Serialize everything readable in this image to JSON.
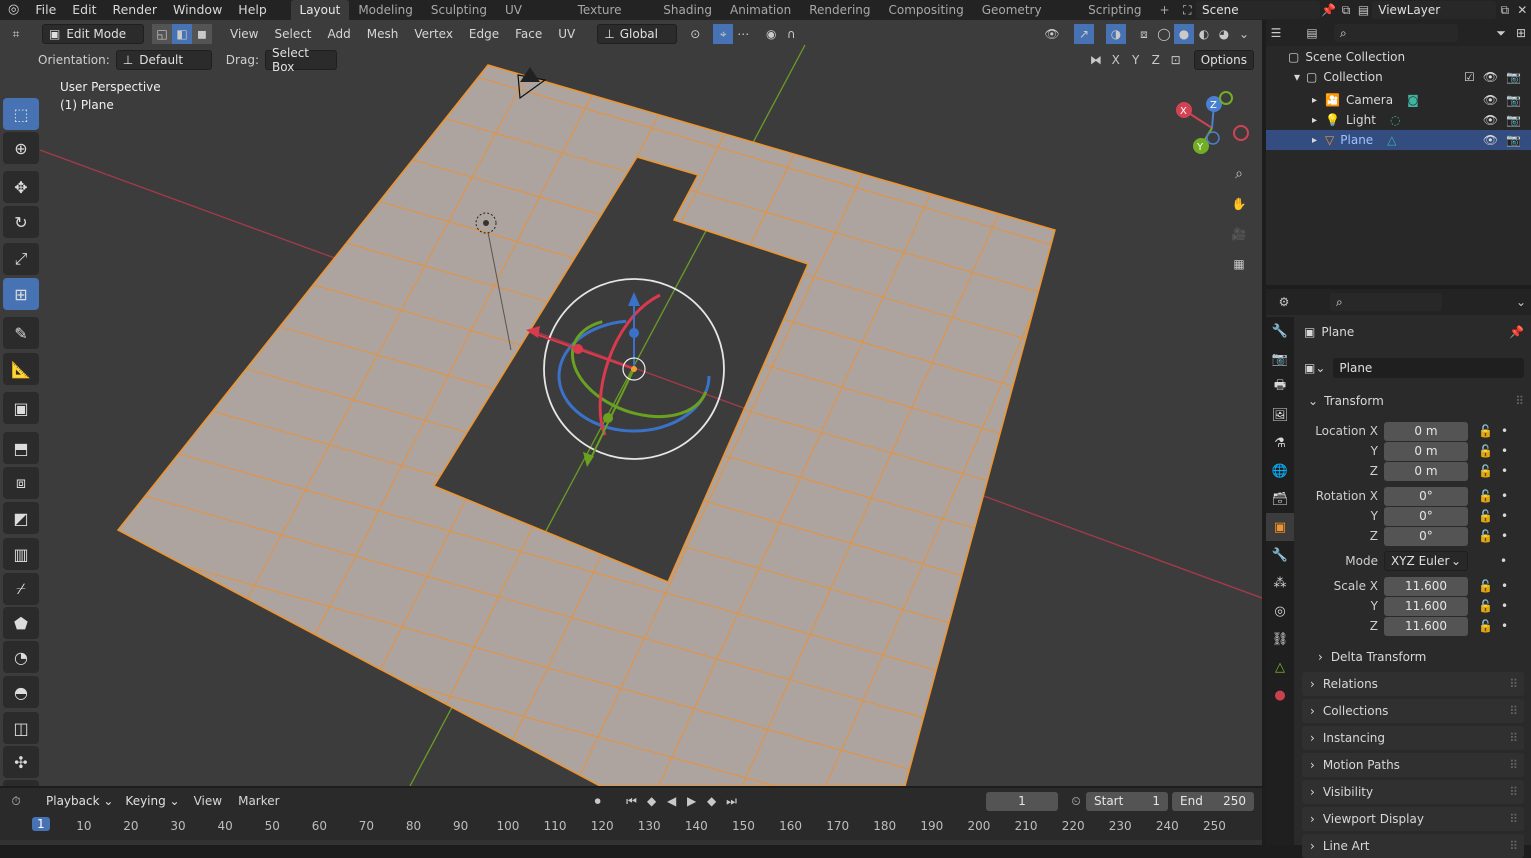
{
  "topbar": {
    "menus": [
      "File",
      "Edit",
      "Render",
      "Window",
      "Help"
    ],
    "workspaces": [
      "Layout",
      "Modeling",
      "Sculpting",
      "UV Editing",
      "Texture Paint",
      "Shading",
      "Animation",
      "Rendering",
      "Compositing",
      "Geometry Nodes",
      "Scripting"
    ],
    "active_workspace": "Layout",
    "add_tab": "+",
    "scene": "Scene",
    "view_layer": "ViewLayer"
  },
  "viewport_header": {
    "mode": "Edit Mode",
    "menus": [
      "View",
      "Select",
      "Add",
      "Mesh",
      "Vertex",
      "Edge",
      "Face",
      "UV"
    ],
    "transform_orientation": "Global",
    "orientation_label": "Orientation:",
    "orientation_value": "Default",
    "drag_label": "Drag:",
    "drag_value": "Select Box",
    "axes": [
      "X",
      "Y",
      "Z"
    ],
    "options": "Options"
  },
  "viewport": {
    "perspective": "User Perspective",
    "object": "(1) Plane",
    "gizmo_axes": {
      "x": "X",
      "y": "Y",
      "z": "Z"
    }
  },
  "tools": [
    {
      "name": "select-box-tool",
      "active": true,
      "glyph": "⬚"
    },
    {
      "name": "cursor-tool",
      "glyph": "⊕"
    },
    {
      "name": "move-tool",
      "glyph": "✥"
    },
    {
      "name": "rotate-tool",
      "glyph": "↻"
    },
    {
      "name": "scale-tool",
      "glyph": "⤢"
    },
    {
      "name": "transform-tool",
      "active": true,
      "glyph": "⊞"
    },
    {
      "name": "annotate-tool",
      "glyph": "✎"
    },
    {
      "name": "measure-tool",
      "glyph": "📐"
    },
    {
      "name": "add-cube-tool",
      "glyph": "▣"
    },
    {
      "name": "extrude-tool",
      "glyph": "⬒"
    },
    {
      "name": "inset-tool",
      "glyph": "⧈"
    },
    {
      "name": "bevel-tool",
      "glyph": "◩"
    },
    {
      "name": "loop-cut-tool",
      "glyph": "▥"
    },
    {
      "name": "knife-tool",
      "glyph": "⌿"
    },
    {
      "name": "poly-build-tool",
      "glyph": "⬟"
    },
    {
      "name": "spin-tool",
      "glyph": "◔"
    },
    {
      "name": "smooth-tool",
      "glyph": "◓"
    },
    {
      "name": "edge-slide-tool",
      "glyph": "◫"
    },
    {
      "name": "shrink-fatten-tool",
      "glyph": "✣"
    },
    {
      "name": "shear-tool",
      "glyph": "▰"
    }
  ],
  "outliner": {
    "root": "Scene Collection",
    "collection": "Collection",
    "items": [
      {
        "label": "Camera",
        "selected": false
      },
      {
        "label": "Light",
        "selected": false
      },
      {
        "label": "Plane",
        "selected": true
      }
    ]
  },
  "properties": {
    "object_name": "Plane",
    "data_name": "Plane",
    "transform_title": "Transform",
    "location": {
      "label": "Location X",
      "x": "0 m",
      "y": "0 m",
      "z": "0 m"
    },
    "rotation": {
      "label": "Rotation X",
      "x": "0°",
      "y": "0°",
      "z": "0°"
    },
    "mode_label": "Mode",
    "mode_value": "XYZ Euler",
    "scale": {
      "label": "Scale X",
      "x": "11.600",
      "y": "11.600",
      "z": "11.600"
    },
    "axis_y": "Y",
    "axis_z": "Z",
    "delta": "Delta Transform",
    "panels": [
      "Relations",
      "Collections",
      "Instancing",
      "Motion Paths",
      "Visibility",
      "Viewport Display",
      "Line Art"
    ]
  },
  "timeline": {
    "menus": [
      "Playback",
      "Keying",
      "View",
      "Marker"
    ],
    "current_frame": "1",
    "start_label": "Start",
    "start": "1",
    "end_label": "End",
    "end": "250",
    "ticks": [
      "1",
      "10",
      "20",
      "30",
      "40",
      "50",
      "60",
      "70",
      "80",
      "90",
      "100",
      "110",
      "120",
      "130",
      "140",
      "150",
      "160",
      "170",
      "180",
      "190",
      "200",
      "210",
      "220",
      "230",
      "240",
      "250"
    ]
  },
  "colors": {
    "accent": "#4772b3",
    "edge": "#f0932b",
    "face": "#ada49f",
    "axis_x": "#c94050",
    "axis_y": "#7ab528"
  }
}
